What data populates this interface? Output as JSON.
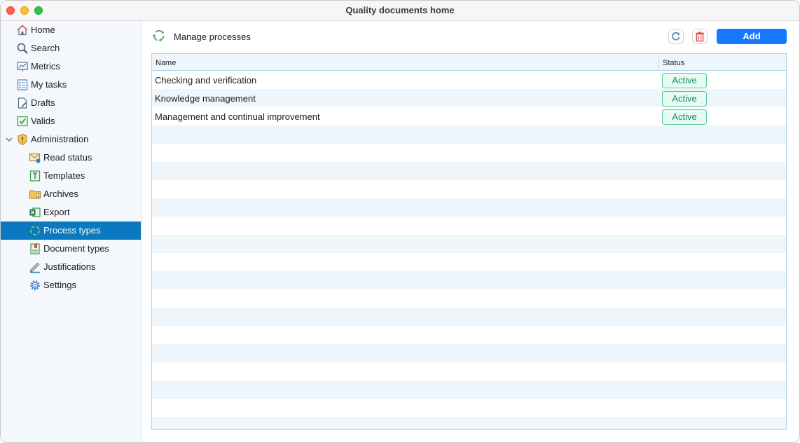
{
  "window": {
    "title": "Quality documents home"
  },
  "sidebar": {
    "items": [
      {
        "label": "Home",
        "icon": "home-icon"
      },
      {
        "label": "Search",
        "icon": "search-icon"
      },
      {
        "label": "Metrics",
        "icon": "metrics-icon"
      },
      {
        "label": "My tasks",
        "icon": "tasks-icon"
      },
      {
        "label": "Drafts",
        "icon": "drafts-icon"
      },
      {
        "label": "Valids",
        "icon": "valids-icon"
      },
      {
        "label": "Administration",
        "icon": "shield-icon",
        "expanded": true
      },
      {
        "label": "Read status",
        "icon": "read-status-icon"
      },
      {
        "label": "Templates",
        "icon": "templates-icon"
      },
      {
        "label": "Archives",
        "icon": "archives-icon"
      },
      {
        "label": "Export",
        "icon": "excel-icon"
      },
      {
        "label": "Process types",
        "icon": "process-icon",
        "selected": true
      },
      {
        "label": "Document types",
        "icon": "document-types-icon"
      },
      {
        "label": "Justifications",
        "icon": "pen-icon"
      },
      {
        "label": "Settings",
        "icon": "gear-icon"
      }
    ]
  },
  "main": {
    "header": {
      "title": "Manage processes",
      "icon": "recycle-icon"
    },
    "toolbar": {
      "add_label": "Add",
      "refresh_icon": "refresh-icon",
      "delete_icon": "trash-icon"
    },
    "table": {
      "columns": [
        "Name",
        "Status"
      ],
      "rows": [
        {
          "name": "Checking and verification",
          "status": "Active"
        },
        {
          "name": "Knowledge management",
          "status": "Active"
        },
        {
          "name": "Management and continual improvement",
          "status": "Active"
        },
        {
          "name": "",
          "status": ""
        },
        {
          "name": "",
          "status": ""
        },
        {
          "name": "",
          "status": ""
        },
        {
          "name": "",
          "status": ""
        },
        {
          "name": "",
          "status": ""
        },
        {
          "name": "",
          "status": ""
        },
        {
          "name": "",
          "status": ""
        },
        {
          "name": "",
          "status": ""
        },
        {
          "name": "",
          "status": ""
        },
        {
          "name": "",
          "status": ""
        },
        {
          "name": "",
          "status": ""
        },
        {
          "name": "",
          "status": ""
        },
        {
          "name": "",
          "status": ""
        },
        {
          "name": "",
          "status": ""
        },
        {
          "name": "",
          "status": ""
        },
        {
          "name": "",
          "status": ""
        },
        {
          "name": "",
          "status": ""
        },
        {
          "name": "",
          "status": ""
        }
      ]
    }
  },
  "colors": {
    "selection": "#0a79bf",
    "add_button": "#1677ff",
    "status_active": "#178c5a",
    "table_border": "#a9d6e6",
    "row_stripe": "#eef5fb"
  }
}
